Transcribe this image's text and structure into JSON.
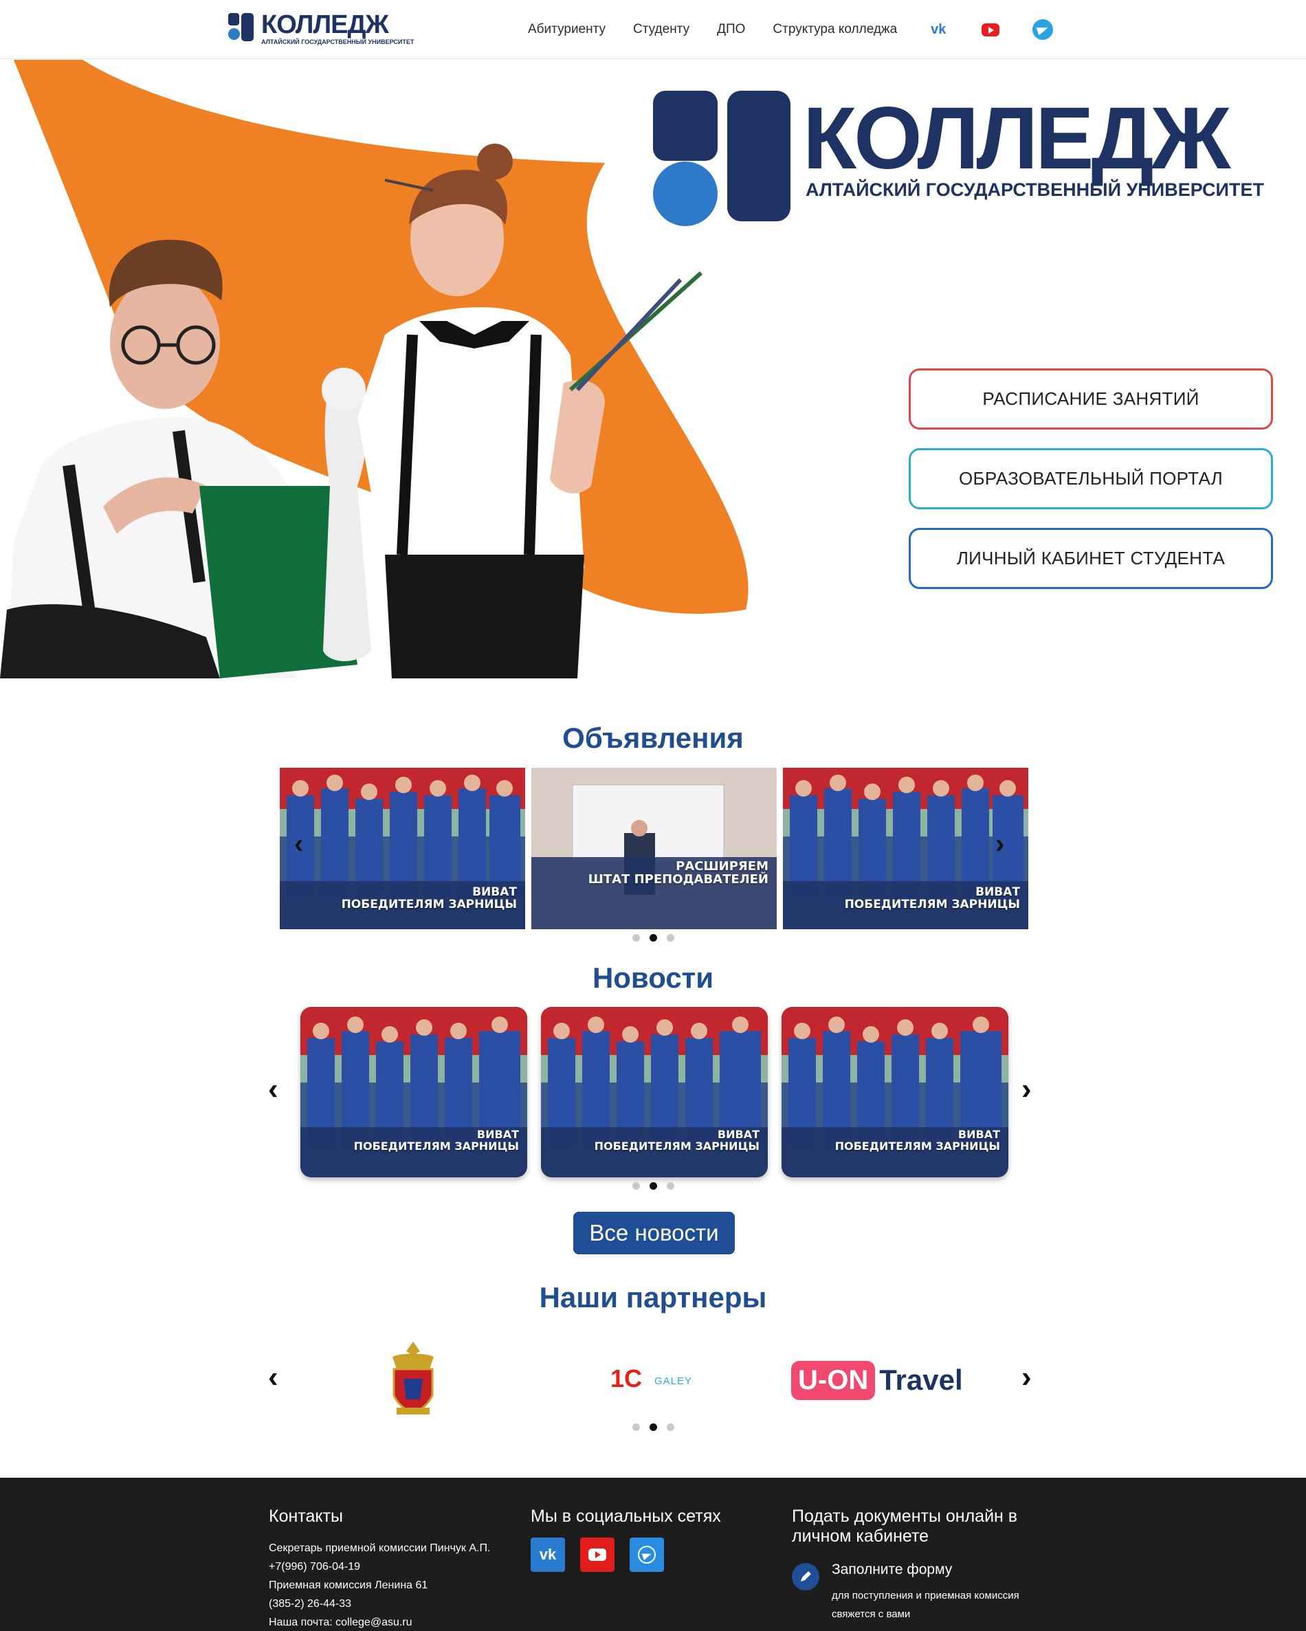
{
  "header": {
    "logo": {
      "title": "КОЛЛЕДЖ",
      "subtitle": "АЛТАЙСКИЙ ГОСУДАРСТВЕННЫЙ УНИВЕРСИТЕТ"
    },
    "nav": [
      "Абитуриенту",
      "Студенту",
      "ДПО",
      "Структура колледжа"
    ],
    "social_icons": [
      "vk-icon",
      "youtube-icon",
      "telegram-icon"
    ]
  },
  "hero": {
    "logo": {
      "title": "КОЛЛЕДЖ",
      "subtitle": "АЛТАЙСКИЙ ГОСУДАРСТВЕННЫЙ УНИВЕРСИТЕТ"
    },
    "buttons": [
      "РАСПИСАНИЕ ЗАНЯТИЙ",
      "ОБРАЗОВАТЕЛЬНЫЙ ПОРТАЛ",
      "ЛИЧНЫЙ КАБИНЕТ СТУДЕНТА"
    ]
  },
  "announcements": {
    "title": "Объявления",
    "cards": [
      {
        "line1": "ВИВАТ",
        "line2": "ПОБЕДИТЕЛЯМ ЗАРНИЦЫ"
      },
      {
        "line1": "РАСШИРЯЕМ",
        "line2": "ШТАТ ПРЕПОДАВАТЕЛЕЙ"
      },
      {
        "line1": "ВИВАТ",
        "line2": "ПОБЕДИТЕЛЯМ ЗАРНИЦЫ"
      }
    ]
  },
  "news": {
    "title": "Новости",
    "cards": [
      {
        "line1": "ВИВАТ",
        "line2": "ПОБЕДИТЕЛЯМ ЗАРНИЦЫ"
      },
      {
        "line1": "ВИВАТ",
        "line2": "ПОБЕДИТЕЛЯМ ЗАРНИЦЫ"
      },
      {
        "line1": "ВИВАТ",
        "line2": "ПОБЕДИТЕЛЯМ ЗАРНИЦЫ"
      }
    ],
    "all_news_button": "Все новости"
  },
  "partners": {
    "title": "Наши партнеры",
    "logos": {
      "one_c": "1С",
      "one_c_sub": "GALEY",
      "uon_a": "U-ON",
      "uon_b": "Travel"
    }
  },
  "footer": {
    "contacts": {
      "title": "Контакты",
      "lines": [
        "Секретарь приемной комиссии Пинчук А.П.",
        "+7(996) 706-04-19",
        "Приемная комиссия Ленина 61",
        "(385-2) 26-44-33",
        "Наша почта: college@asu.ru"
      ]
    },
    "social": {
      "title": "Мы в социальных сетях"
    },
    "apply": {
      "title": "Подать документы онлайн в личном кабинете",
      "item_title": "Заполните форму",
      "item_text": "для поступления и приемная комиссия свяжется с вами"
    }
  },
  "colors": {
    "brand_dark": "#1f3264",
    "brand_blue": "#2f79c9",
    "title_blue": "#214e93",
    "orange": "#ef8024",
    "footer_bg": "#1d1d1d"
  }
}
